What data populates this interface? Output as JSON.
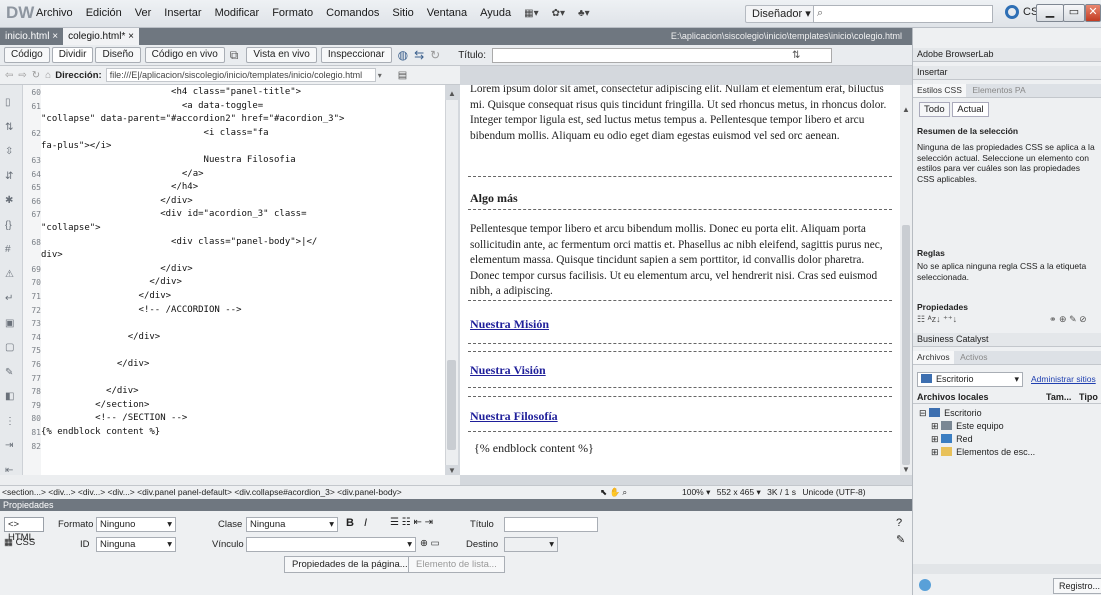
{
  "app": {
    "logo": "DW"
  },
  "menu": [
    "Archivo",
    "Edición",
    "Ver",
    "Insertar",
    "Modificar",
    "Formato",
    "Comandos",
    "Sitio",
    "Ventana",
    "Ayuda"
  ],
  "toolbar": {
    "layout_icon": "layout-icon",
    "extend_icon": "gear-icon",
    "site_icon": "site-icon"
  },
  "workspace": {
    "label": "Diseñador ▾"
  },
  "cslive": {
    "label": "CS Live"
  },
  "doc_tabs": [
    {
      "label": "inicio.html",
      "close": "×"
    },
    {
      "label": "colegio.html*",
      "close": "×"
    }
  ],
  "filepath": "E:\\aplicacion\\siscolegio\\inicio\\templates\\inicio\\colegio.html",
  "view_buttons": {
    "code": "Código",
    "split": "Dividir",
    "design": "Diseño",
    "live_code": "Código en vivo",
    "live_view": "Vista en vivo",
    "inspect": "Inspeccionar",
    "title_label": "Título:"
  },
  "address": {
    "label": "Dirección:",
    "value": "file:///E|/aplicacion/siscolegio/inicio/templates/inicio/colegio.html"
  },
  "code_lines": [
    {
      "n": "60",
      "t": "                        <h4 class=\"panel-title\">"
    },
    {
      "n": "61",
      "t": "                          <a data-toggle="
    },
    {
      "n": "",
      "t": "\"collapse\" data-parent=\"#accordion2\" href=\"#acordion_3\">"
    },
    {
      "n": "62",
      "t": "                              <i class=\"fa"
    },
    {
      "n": "",
      "t": "fa-plus\"></i>"
    },
    {
      "n": "63",
      "t": "                              Nuestra Filosofia"
    },
    {
      "n": "64",
      "t": "                          </a>"
    },
    {
      "n": "65",
      "t": "                        </h4>"
    },
    {
      "n": "66",
      "t": "                      </div>"
    },
    {
      "n": "67",
      "t": "                      <div id=\"acordion_3\" class="
    },
    {
      "n": "",
      "t": "\"collapse\">"
    },
    {
      "n": "68",
      "t": "                        <div class=\"panel-body\">|</"
    },
    {
      "n": "",
      "t": "div>"
    },
    {
      "n": "69",
      "t": "                      </div>"
    },
    {
      "n": "70",
      "t": "                    </div>"
    },
    {
      "n": "71",
      "t": "                  </div>"
    },
    {
      "n": "72",
      "t": "                  <!-- /ACCORDION -->"
    },
    {
      "n": "73",
      "t": ""
    },
    {
      "n": "74",
      "t": "                </div>"
    },
    {
      "n": "75",
      "t": ""
    },
    {
      "n": "76",
      "t": "              </div>"
    },
    {
      "n": "77",
      "t": ""
    },
    {
      "n": "78",
      "t": "            </div>"
    },
    {
      "n": "79",
      "t": "          </section>"
    },
    {
      "n": "80",
      "t": "          <!-- /SECTION -->"
    },
    {
      "n": "81",
      "t": "{% endblock content %}"
    },
    {
      "n": "82",
      "t": ""
    }
  ],
  "design": {
    "para1": "Lorem ipsum dolor sit amet, consectetur adipiscing elit. Nullam et elementum erat, biluctus mi. Quisque consequat risus quis tincidunt fringilla. Ut sed rhoncus metus, in rhoncus dolor. Integer tempor ligula est, sed luctus metus tempus a. Pellentesque tempor libero et arcu bibendum mollis. Aliquam eu odio eget diam egestas euismod vel sed orc aenean.",
    "heading": "Algo más",
    "para2": "Pellentesque tempor libero et arcu bibendum mollis. Donec eu porta elit. Aliquam porta sollicitudin ante, ac fermentum orci mattis et. Phasellus ac nibh eleifend, sagittis purus nec, elementum massa. Quisque tincidunt sapien a sem porttitor, id convallis dolor pharetra. Donec tempor cursus facilisis. Ut eu elementum arcu, vel hendrerit nisi. Cras sed euismod nibh, a adipiscing.",
    "links": [
      "Nuestra Misión",
      "Nuestra Visión",
      "Nuestra Filosofía"
    ],
    "endblock": "{% endblock content %}"
  },
  "status": {
    "tags": "<section...> <div...> <div...> <div...> <div.panel panel-default> <div.collapse#acordion_3> <div.panel-body>",
    "zoom": "100%",
    "size": "552 x 465 ▾",
    "speed": "3K / 1 s",
    "encoding": "Unicode (UTF-8)"
  },
  "properties": {
    "header": "Propiedades",
    "html": "HTML",
    "css": "CSS",
    "formato_label": "Formato",
    "formato_value": "Ninguno",
    "clase_label": "Clase",
    "clase_value": "Ninguna",
    "id_label": "ID",
    "id_value": "Ninguna",
    "vinculo_label": "Vínculo",
    "titulo_label": "Título",
    "destino_label": "Destino",
    "page_props": "Propiedades de la página...",
    "list_item": "Elemento de lista..."
  },
  "right_panel": {
    "browserlab": "Adobe BrowserLab",
    "insertar": "Insertar",
    "tab_css": "Estilos CSS",
    "tab_ap": "Elementos PA",
    "todo": "Todo",
    "actual": "Actual",
    "resumen": "Resumen de la selección",
    "resumen_text": "Ninguna de las propiedades CSS se aplica a la selección actual. Seleccione un elemento con estilos para ver cuáles son las propiedades CSS aplicables.",
    "reglas": "Reglas",
    "reglas_text": "No se aplica ninguna regla CSS a la etiqueta seleccionada.",
    "propiedades": "Propiedades",
    "business": "Business Catalyst",
    "tab_archivos": "Archivos",
    "tab_activos": "Activos",
    "location": "Escritorio",
    "admin_link": "Administrar sitios",
    "col_local": "Archivos locales",
    "col_size": "Tam...",
    "col_type": "Tipo",
    "tree": [
      "Escritorio",
      "Este equipo",
      "Red",
      "Elementos de esc..."
    ],
    "registro": "Registro..."
  }
}
